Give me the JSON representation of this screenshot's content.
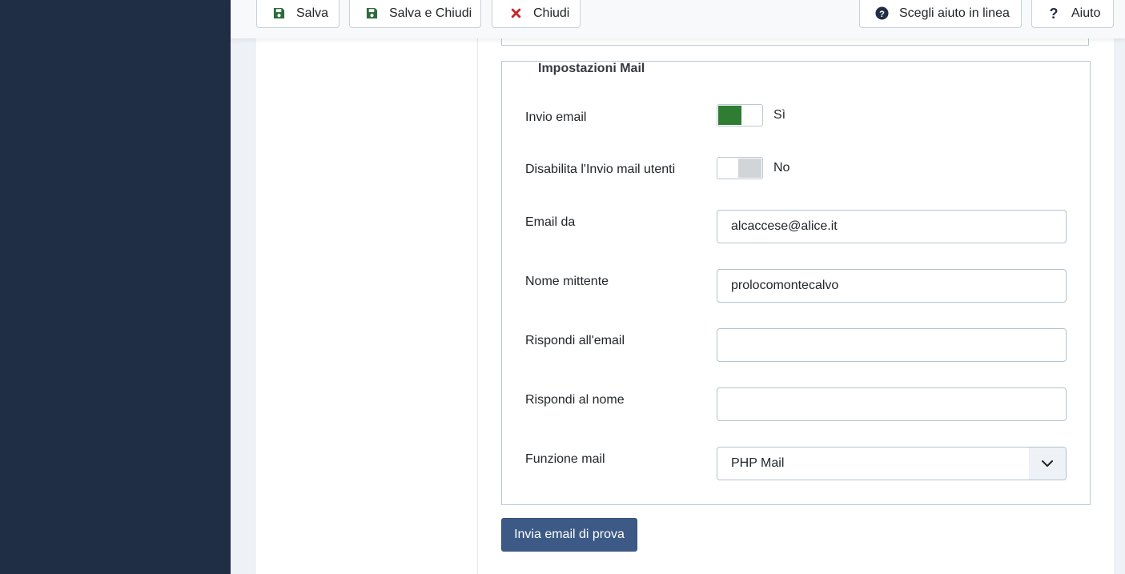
{
  "colors": {
    "sidebar_bg": "#1f2d45",
    "switch_on": "#2e7d32",
    "switch_off": "#d2d5d8",
    "primary_button": "#3c5a85",
    "close_icon": "#c62828",
    "save_icon": "#2e6b3a"
  },
  "toolbar": {
    "save_label": "Salva",
    "save_close_label": "Salva e Chiudi",
    "close_label": "Chiudi",
    "help_choose_label": "Scegli aiuto in linea",
    "help_label": "Aiuto"
  },
  "mail_settings": {
    "legend": "Impostazioni Mail",
    "send_email": {
      "label": "Invio email",
      "state": "Sì"
    },
    "disable_user_mail": {
      "label": "Disabilita l'Invio mail utenti",
      "state": "No"
    },
    "email_from": {
      "label": "Email da",
      "value": "alcaccese@alice.it"
    },
    "from_name": {
      "label": "Nome mittente",
      "value": "prolocomontecalvo"
    },
    "reply_to_email": {
      "label": "Rispondi all'email",
      "value": ""
    },
    "reply_to_name": {
      "label": "Rispondi al nome",
      "value": ""
    },
    "mailer": {
      "label": "Funzione mail",
      "value": "PHP Mail"
    }
  },
  "test_mail_button": "Invia email di prova"
}
